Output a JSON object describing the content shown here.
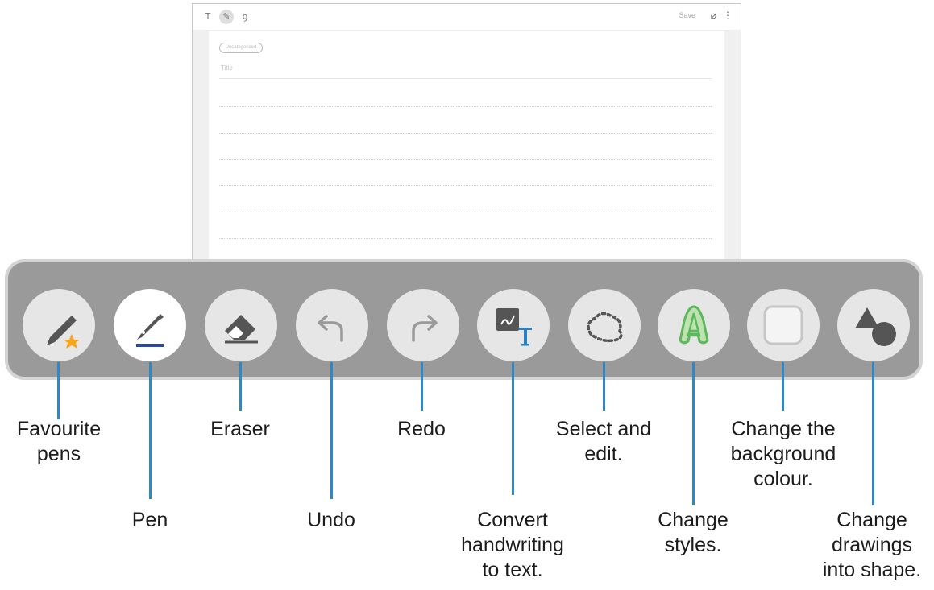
{
  "note": {
    "toolbar": {
      "text_mode_icon": "T",
      "pen_mode_icon": "pen-mode-icon",
      "brush_mode_icon": "brush-mode-icon",
      "save_label": "Save",
      "attach_icon": "paperclip-icon",
      "more_icon": "more-vertical-icon"
    },
    "category_placeholder": "Uncategorised",
    "title_placeholder": "Title"
  },
  "tools": [
    {
      "id": "favourite-pens",
      "icon": "pen-star-icon",
      "label": "Favourite\npens"
    },
    {
      "id": "pen",
      "icon": "fountain-pen-icon",
      "label": "Pen",
      "selected": true
    },
    {
      "id": "eraser",
      "icon": "eraser-icon",
      "label": "Eraser"
    },
    {
      "id": "undo",
      "icon": "undo-arrow-icon",
      "label": "Undo"
    },
    {
      "id": "redo",
      "icon": "redo-arrow-icon",
      "label": "Redo"
    },
    {
      "id": "convert",
      "icon": "handwriting-to-text-icon",
      "label": "Convert\nhandwriting\nto text."
    },
    {
      "id": "select",
      "icon": "lasso-select-icon",
      "label": "Select and\nedit."
    },
    {
      "id": "styles",
      "icon": "outlined-letter-a-icon",
      "label": "Change\nstyles."
    },
    {
      "id": "background",
      "icon": "rounded-square-icon",
      "label": "Change the\nbackground\ncolour."
    },
    {
      "id": "shape",
      "icon": "triangle-circle-shape-icon",
      "label": "Change\ndrawings\ninto shape."
    }
  ],
  "colors": {
    "toolbar_bg": "#9a9a9a",
    "toolbar_border": "#d4d4d4",
    "tool_bg": "#e6e6e6",
    "leader_line": "#2f87c4",
    "star": "#f5a623",
    "pen_underline": "#2b4a9e",
    "convert_t": "#2a7fc0",
    "styles_green": "#5cb85c"
  }
}
